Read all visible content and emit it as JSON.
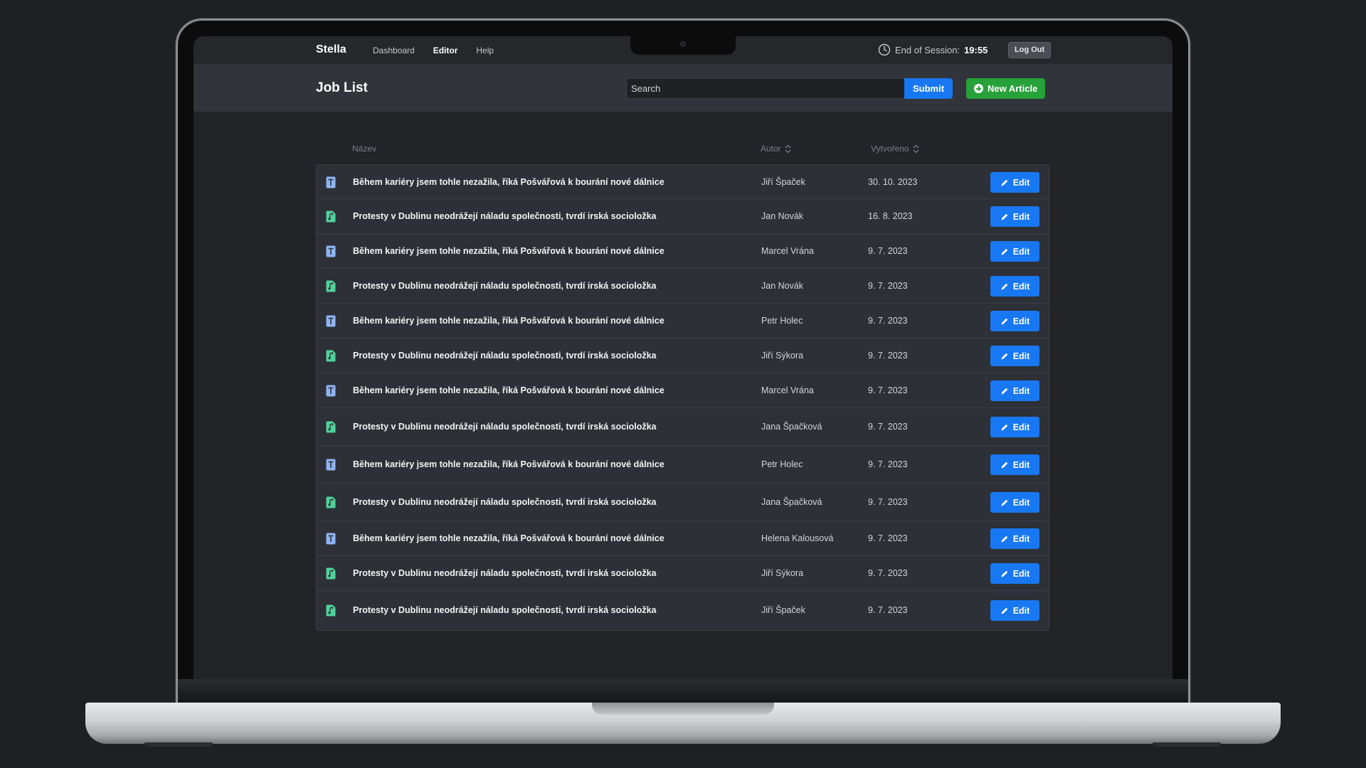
{
  "navbar": {
    "brand": "Stella",
    "links": [
      {
        "label": "Dashboard",
        "active": false
      },
      {
        "label": "Editor",
        "active": true
      },
      {
        "label": "Help",
        "active": false
      }
    ],
    "session_label": "End of Session:",
    "session_time": "19:55",
    "logout_label": "Log Out"
  },
  "subheader": {
    "title": "Job List",
    "search_placeholder": "Search",
    "submit_label": "Submit",
    "new_article_label": "New Article"
  },
  "table": {
    "columns": {
      "name": "Název",
      "author": "Autor",
      "created": "Vytvořeno"
    },
    "edit_label": "Edit",
    "rows": [
      {
        "type": "text",
        "title": "Během kariéry jsem tohle nezažila, říká Pošvářová k bourání nové dálnice",
        "author": "Jiří Špaček",
        "date": "30. 10. 2023"
      },
      {
        "type": "audio",
        "title": "Protesty v Dublinu neodrážejí náladu společnosti, tvrdí irská socioložka",
        "author": "Jan Novák",
        "date": "16. 8. 2023"
      },
      {
        "type": "text",
        "title": "Během kariéry jsem tohle nezažila, říká Pošvářová k bourání nové dálnice",
        "author": "Marcel Vrána",
        "date": "9. 7. 2023"
      },
      {
        "type": "audio",
        "title": "Protesty v Dublinu neodrážejí náladu společnosti, tvrdí irská socioložka",
        "author": "Jan Novák",
        "date": "9. 7. 2023"
      },
      {
        "type": "text",
        "title": "Během kariéry jsem tohle nezažila, říká Pošvářová k bourání nové dálnice",
        "author": "Petr Holec",
        "date": "9. 7. 2023"
      },
      {
        "type": "audio",
        "title": "Protesty v Dublinu neodrážejí náladu společnosti, tvrdí irská socioložka",
        "author": "Jiří Sýkora",
        "date": "9. 7. 2023"
      },
      {
        "type": "text",
        "title": "Během kariéry jsem tohle nezažila, říká Pošvářová k bourání nové dálnice",
        "author": "Marcel Vrána",
        "date": "9. 7. 2023"
      },
      {
        "type": "audio",
        "title": "Protesty v Dublinu neodrážejí náladu společnosti, tvrdí irská socioložka",
        "author": "Jana Špačková",
        "date": "9. 7. 2023"
      },
      {
        "type": "text",
        "title": "Během kariéry jsem tohle nezažila, říká Pošvářová k bourání nové dálnice",
        "author": "Petr Holec",
        "date": "9. 7. 2023"
      },
      {
        "type": "audio",
        "title": "Protesty v Dublinu neodrážejí náladu společnosti, tvrdí irská socioložka",
        "author": "Jana Špačková",
        "date": "9. 7. 2023"
      },
      {
        "type": "text",
        "title": "Během kariéry jsem tohle nezažila, říká Pošvářová k bourání nové dálnice",
        "author": "Helena Kalousová",
        "date": "9. 7. 2023"
      },
      {
        "type": "audio",
        "title": "Protesty v Dublinu neodrážejí náladu společnosti, tvrdí irská socioložka",
        "author": "Jiří Sýkora",
        "date": "9. 7. 2023"
      },
      {
        "type": "audio",
        "title": "Protesty v Dublinu neodrážejí náladu společnosti, tvrdí irská socioložka",
        "author": "Jiří Špaček",
        "date": "9. 7. 2023"
      }
    ]
  },
  "icons": {
    "text_type": "text-document-icon",
    "audio_type": "audio-file-icon",
    "edit": "pencil-icon",
    "session": "clock-icon",
    "new_article": "plus-circle-icon",
    "sort": "sort-icon"
  },
  "colors": {
    "primary": "#1877f2",
    "success": "#27a13a",
    "text_icon": "#8fb4f5",
    "audio_icon": "#4fd39a"
  }
}
